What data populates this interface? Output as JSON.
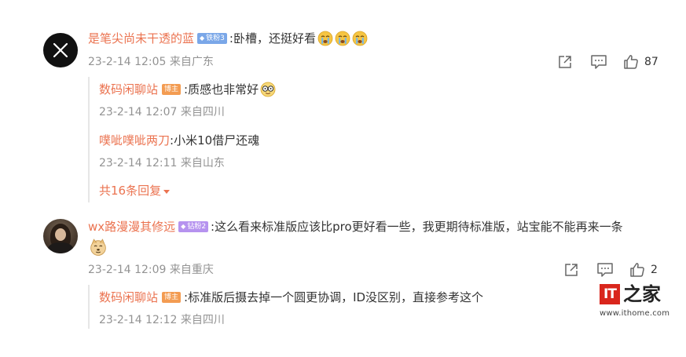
{
  "comments": [
    {
      "user": "是笔尖尚未干透的蓝",
      "badge": "铁粉3",
      "text": ":卧槽，还挺好看",
      "emoji": [
        "crying-face",
        "crying-face",
        "crying-face"
      ],
      "time": "23-2-14 12:05 来自广东",
      "likes": "87",
      "replies": [
        {
          "user": "数码闲聊站",
          "badge": "博主",
          "text": ":质感也非常好",
          "emoji": [
            "glasses-face"
          ],
          "time": "23-2-14 12:07 来自四川"
        },
        {
          "user": "噗呲噗呲两刀",
          "text": ":小米10借尸还魂",
          "time": "23-2-14 12:11 来自山东"
        }
      ],
      "more_replies": "共16条回复"
    },
    {
      "user": "wx路漫漫其修远",
      "badge": "钻粉2",
      "text": ":这么看来标准版应该比pro更好看一些，我更期待标准版，站宝能不能再来一条",
      "emoji": [
        "doge-face"
      ],
      "time": "23-2-14 12:09 来自重庆",
      "likes": "2",
      "replies": [
        {
          "user": "数码闲聊站",
          "badge": "博主",
          "text": ":标准版后摄去掉一个圆更协调，ID没区别，直接参考这个",
          "time": "23-2-14 12:12 来自四川"
        }
      ]
    }
  ],
  "watermark": {
    "logo_text": "IT之家",
    "url": "www.ithome.com"
  },
  "colors": {
    "username": "#eb7350",
    "meta": "#939393",
    "fan_badge": "#7aa7e8",
    "diamond_badge": "#b693ef",
    "host_badge": "#f39c52",
    "logo_red": "#d9261c"
  }
}
